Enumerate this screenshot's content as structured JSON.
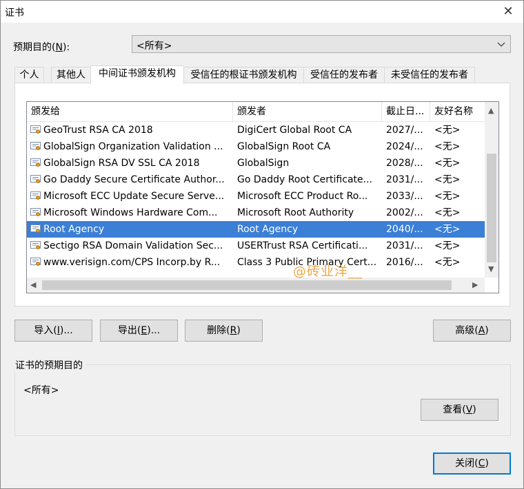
{
  "window": {
    "title": "证书"
  },
  "purpose": {
    "label": "预期目的(",
    "hotkey": "N",
    "label_tail": "):",
    "selected": "<所有>"
  },
  "tabs": [
    {
      "label": "个人"
    },
    {
      "label": "其他人"
    },
    {
      "label": "中间证书颁发机构",
      "active": true
    },
    {
      "label": "受信任的根证书颁发机构"
    },
    {
      "label": "受信任的发布者"
    },
    {
      "label": "未受信任的发布者"
    }
  ],
  "table": {
    "columns": [
      "颁发给",
      "颁发者",
      "截止日...",
      "友好名称"
    ],
    "rows": [
      {
        "issued_to": "GeoTrust RSA CA 2018",
        "issuer": "DigiCert Global Root CA",
        "expires": "2027/...",
        "friendly": "<无>"
      },
      {
        "issued_to": "GlobalSign Organization Validation ...",
        "issuer": "GlobalSign Root CA",
        "expires": "2024/...",
        "friendly": "<无>"
      },
      {
        "issued_to": "GlobalSign RSA DV SSL CA 2018",
        "issuer": "GlobalSign",
        "expires": "2028/...",
        "friendly": "<无>"
      },
      {
        "issued_to": "Go Daddy Secure Certificate Author...",
        "issuer": "Go Daddy Root Certificate...",
        "expires": "2031/...",
        "friendly": "<无>"
      },
      {
        "issued_to": "Microsoft ECC Update Secure Serve...",
        "issuer": "Microsoft ECC Product Ro...",
        "expires": "2033/...",
        "friendly": "<无>"
      },
      {
        "issued_to": "Microsoft Windows Hardware Com...",
        "issuer": "Microsoft Root Authority",
        "expires": "2002/...",
        "friendly": "<无>"
      },
      {
        "issued_to": "Root Agency",
        "issuer": "Root Agency",
        "expires": "2040/...",
        "friendly": "<无>",
        "selected": true
      },
      {
        "issued_to": "Sectigo RSA Domain Validation Sec...",
        "issuer": "USERTrust RSA Certificati...",
        "expires": "2031/...",
        "friendly": "<无>"
      },
      {
        "issued_to": "www.verisign.com/CPS Incorp.by R...",
        "issuer": "Class 3 Public Primary Cert...",
        "expires": "2016/...",
        "friendly": "<无>"
      }
    ]
  },
  "buttons": {
    "import": {
      "label": "导入(",
      "hotkey": "I",
      "tail": ")..."
    },
    "export": {
      "label": "导出(",
      "hotkey": "E",
      "tail": ")..."
    },
    "remove": {
      "label": "删除(",
      "hotkey": "R",
      "tail": ")"
    },
    "advanced": {
      "label": "高级(",
      "hotkey": "A",
      "tail": ")"
    },
    "view": {
      "label": "查看(",
      "hotkey": "V",
      "tail": ")"
    },
    "close": {
      "label": "关闭(",
      "hotkey": "C",
      "tail": ")"
    }
  },
  "purposes_group": {
    "title": "证书的预期目的",
    "value": "<所有>"
  },
  "watermark": "@砖业洋__",
  "colors": {
    "selection": "#3b7fd6",
    "default_button_border": "#0078d7",
    "watermark": "#e89a2c"
  }
}
